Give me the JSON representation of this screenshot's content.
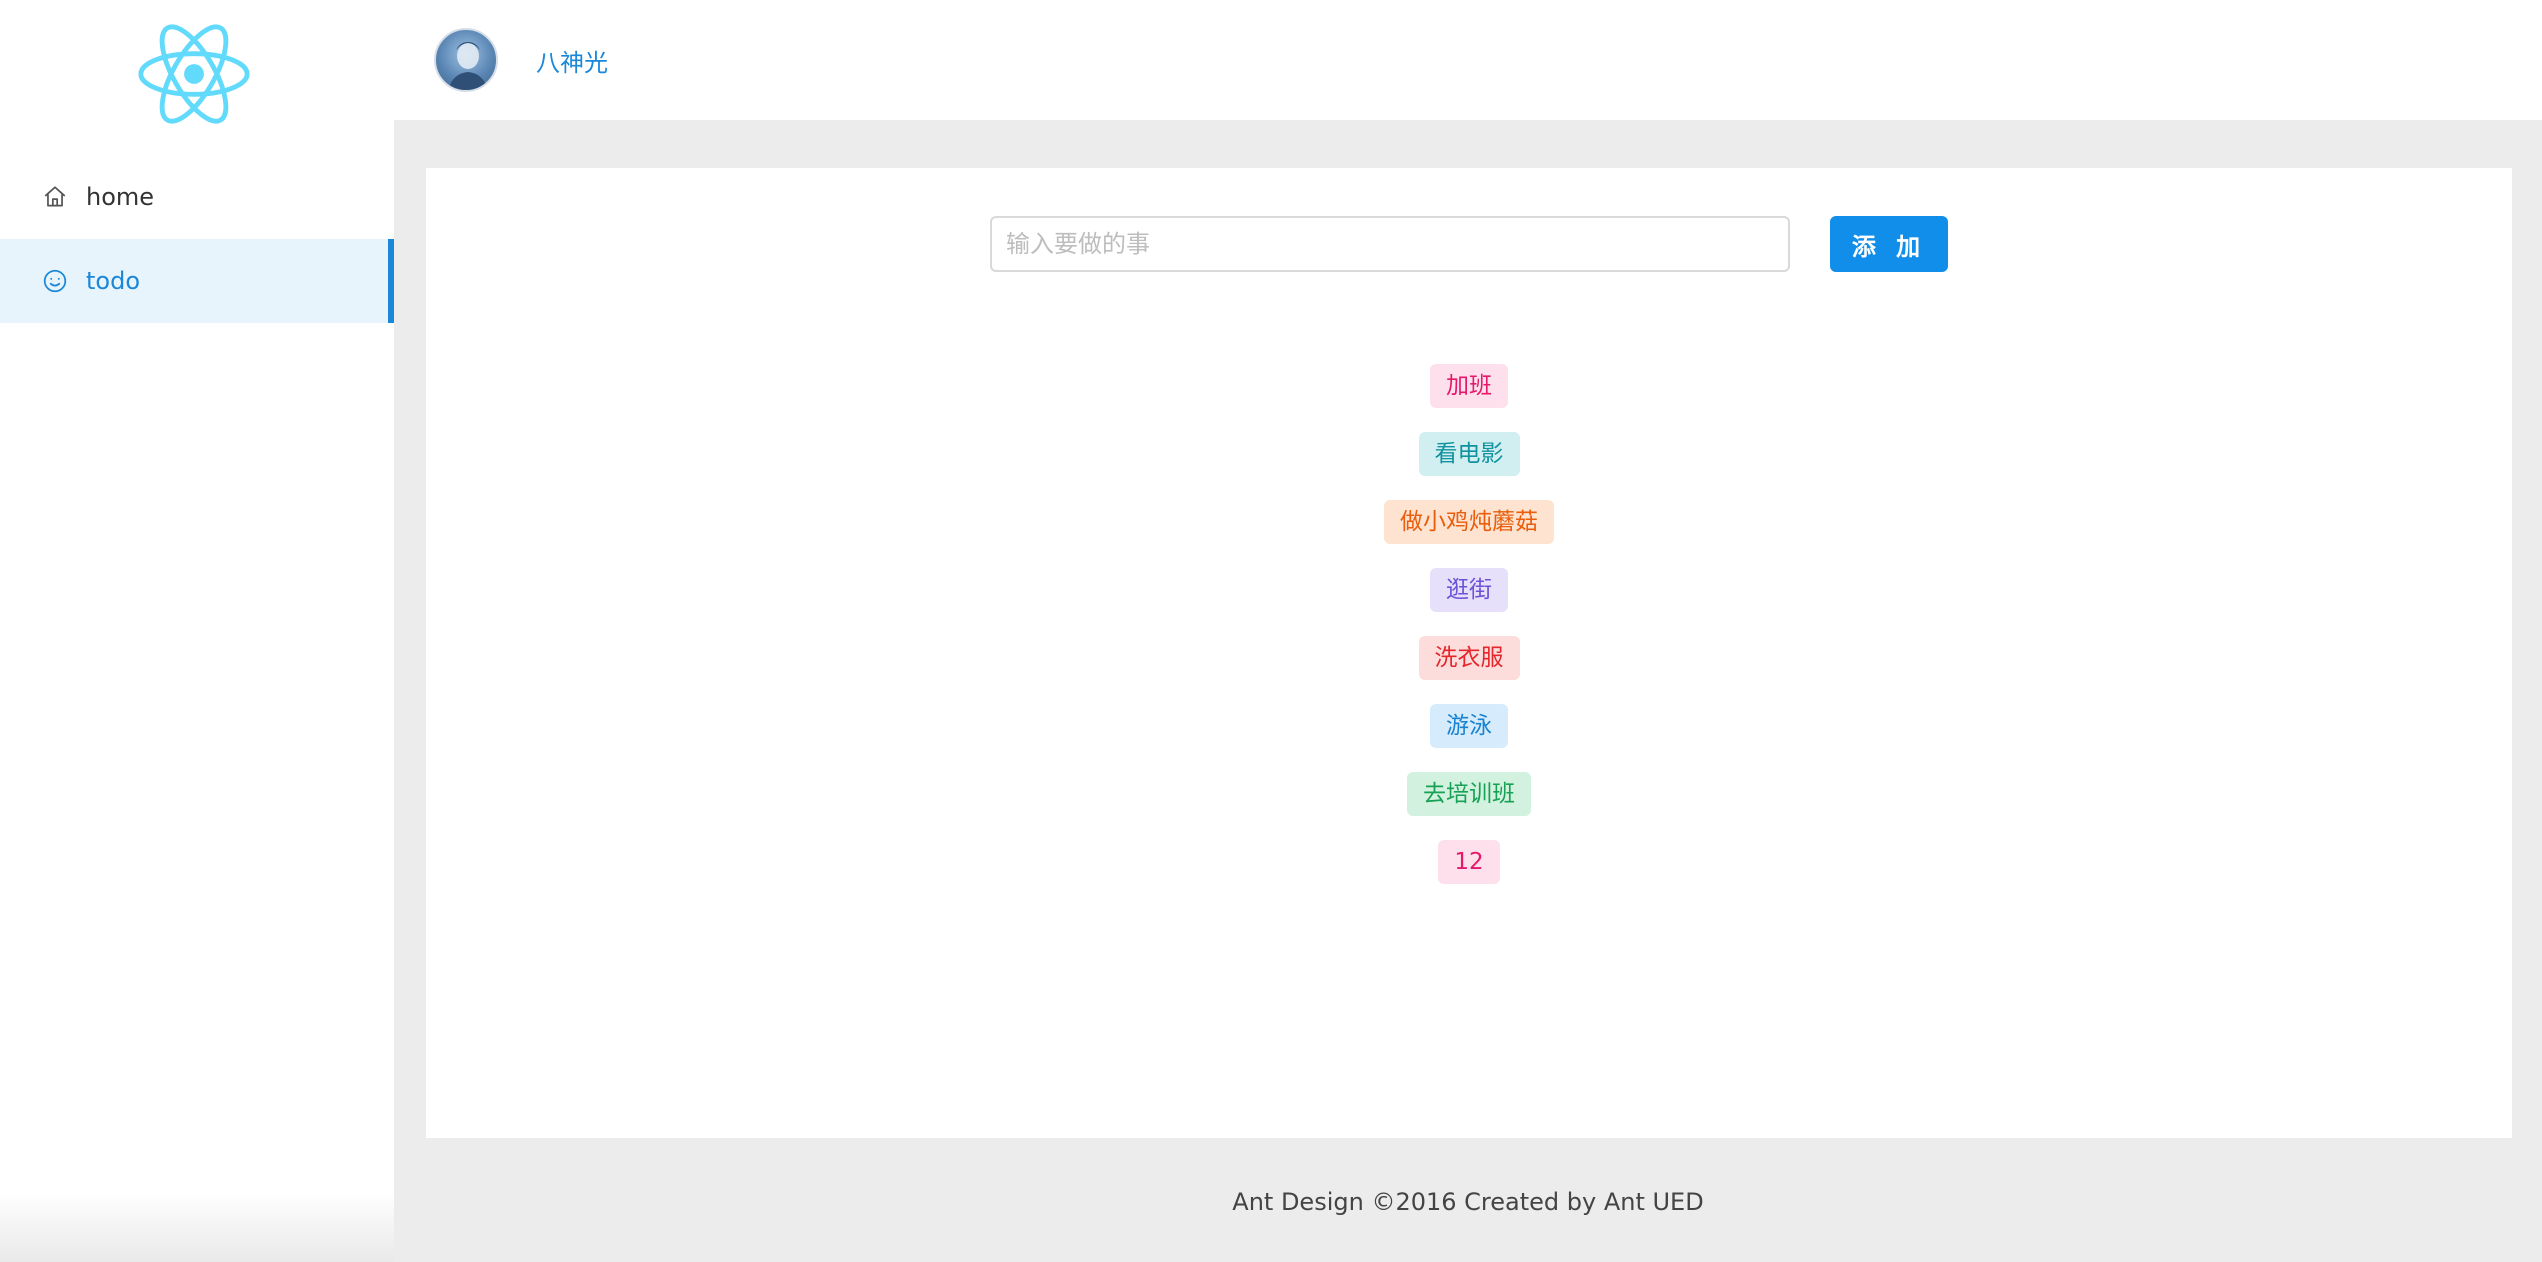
{
  "header": {
    "username": "八神光"
  },
  "sidebar": {
    "items": [
      {
        "label": "home",
        "icon": "home-icon",
        "selected": false
      },
      {
        "label": "todo",
        "icon": "smile-icon",
        "selected": true
      }
    ]
  },
  "todo": {
    "input_placeholder": "输入要做的事",
    "add_label": "添 加",
    "items": [
      {
        "label": "加班",
        "color": "#e5186b",
        "bg": "#fde0ec"
      },
      {
        "label": "看电影",
        "color": "#10939f",
        "bg": "#d1eef1"
      },
      {
        "label": "做小鸡炖蘑菇",
        "color": "#ea5d0c",
        "bg": "#fde3d0"
      },
      {
        "label": "逛街",
        "color": "#6c52d6",
        "bg": "#e6e0fb"
      },
      {
        "label": "洗衣服",
        "color": "#e5262b",
        "bg": "#fddcdc"
      },
      {
        "label": "游泳",
        "color": "#1883d3",
        "bg": "#d6ebfb"
      },
      {
        "label": "去培训班",
        "color": "#16a155",
        "bg": "#d2f1df"
      },
      {
        "label": "12",
        "color": "#e5186b",
        "bg": "#fde0ec"
      }
    ]
  },
  "footer": {
    "text": "Ant Design ©2016 Created by Ant UED"
  },
  "colors": {
    "primary": "#108ee9",
    "logo": "#61dafb",
    "selected_bg": "#e8f4fc",
    "content_bg": "#ececec"
  }
}
